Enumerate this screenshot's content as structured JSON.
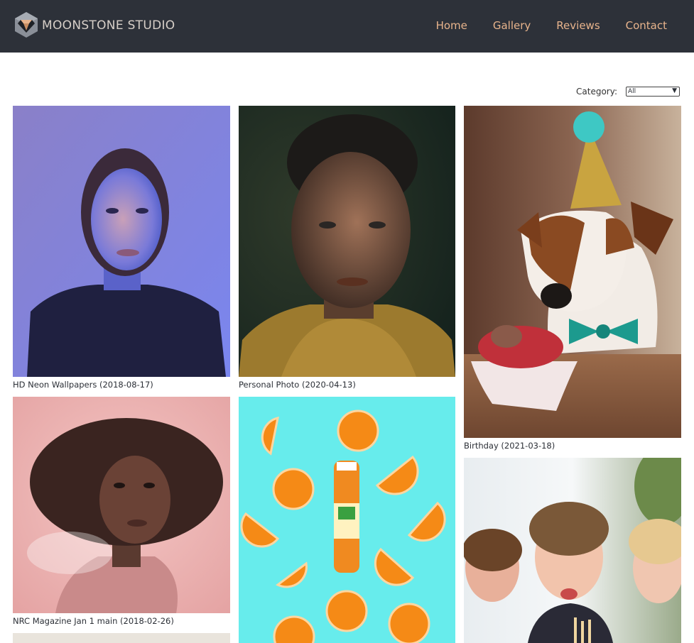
{
  "header": {
    "brand": "MOONSTONE STUDIO",
    "logo_icon": "gem-logo-icon",
    "nav": [
      {
        "label": "Home"
      },
      {
        "label": "Gallery"
      },
      {
        "label": "Reviews"
      },
      {
        "label": "Contact"
      }
    ],
    "colors": {
      "background": "#2d3139",
      "nav_link": "#e8b48c",
      "brand_text": "#d7cfc8"
    }
  },
  "filter": {
    "label": "Category:",
    "selected": "All"
  },
  "gallery": [
    {
      "caption": "HD Neon Wallpapers (2018-08-17)"
    },
    {
      "caption": "Personal Photo (2020-04-13)"
    },
    {
      "caption": "Birthday (2021-03-18)"
    },
    {
      "caption": "NRC Magazine Jan 1 main (2018-02-26)"
    },
    {
      "caption": ""
    },
    {
      "caption": ""
    }
  ]
}
